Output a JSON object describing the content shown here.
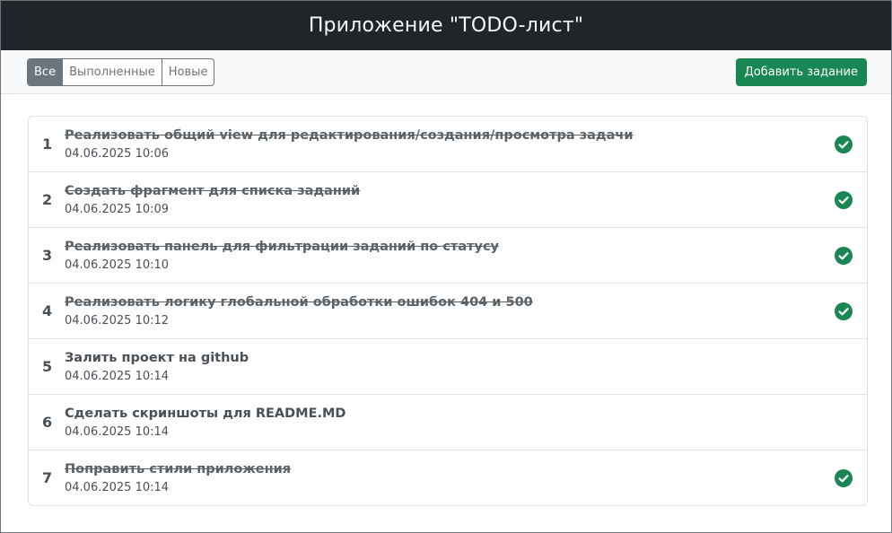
{
  "header": {
    "title": "Приложение \"TODO-лист\""
  },
  "toolbar": {
    "filters": [
      {
        "label": "Все",
        "active": true
      },
      {
        "label": "Выполненные",
        "active": false
      },
      {
        "label": "Новые",
        "active": false
      }
    ],
    "add_label": "Добавить задание"
  },
  "colors": {
    "header_bg": "#212529",
    "accent_green": "#198754",
    "secondary": "#6c757d"
  },
  "tasks": [
    {
      "number": "1",
      "title": "Реализовать общий view для редактирования/создания/просмотра задачи",
      "date": "04.06.2025 10:06",
      "done": true
    },
    {
      "number": "2",
      "title": "Создать фрагмент для списка заданий",
      "date": "04.06.2025 10:09",
      "done": true
    },
    {
      "number": "3",
      "title": "Реализовать панель для фильтрации заданий по статусу",
      "date": "04.06.2025 10:10",
      "done": true
    },
    {
      "number": "4",
      "title": "Реализовать логику глобальной обработки ошибок 404 и 500",
      "date": "04.06.2025 10:12",
      "done": true
    },
    {
      "number": "5",
      "title": "Залить проект на github",
      "date": "04.06.2025 10:14",
      "done": false
    },
    {
      "number": "6",
      "title": "Сделать скриншоты для README.MD",
      "date": "04.06.2025 10:14",
      "done": false
    },
    {
      "number": "7",
      "title": "Поправить стили приложения",
      "date": "04.06.2025 10:14",
      "done": true
    }
  ],
  "icons": {
    "done": "check-circle-icon"
  }
}
